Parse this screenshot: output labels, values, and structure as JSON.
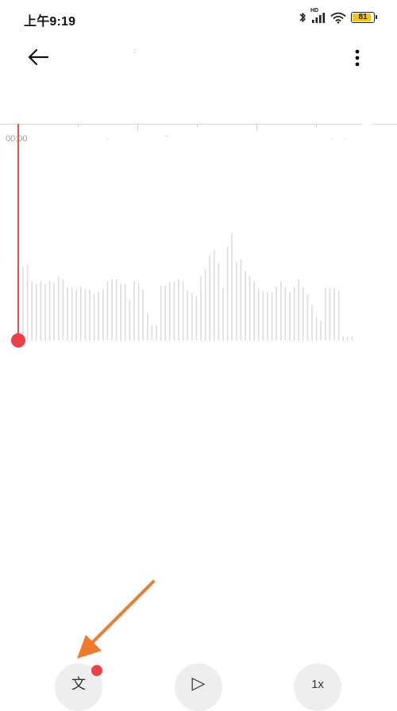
{
  "status_bar": {
    "time": "上午9:19",
    "network_label": "HD",
    "battery_level": "81",
    "battery_fraction": 0.81,
    "icons": [
      "bluetooth-icon",
      "signal-icon",
      "wifi-icon",
      "battery-icon"
    ]
  },
  "toolbar": {
    "back_icon": "arrow-left-icon",
    "title": "=",
    "more_icon": "more-vertical-icon"
  },
  "timeline": {
    "start_time": "00:00",
    "faint_marks": [
      "-",
      "–",
      "·",
      "·"
    ]
  },
  "waveform": {
    "accent_color": "#ee4b4b",
    "bar_color": "#dcdcdc",
    "levels": [
      0.56,
      0.58,
      0.45,
      0.43,
      0.45,
      0.43,
      0.45,
      0.44,
      0.49,
      0.47,
      0.41,
      0.41,
      0.39,
      0.41,
      0.39,
      0.39,
      0.35,
      0.37,
      0.39,
      0.45,
      0.47,
      0.47,
      0.43,
      0.43,
      0.31,
      0.45,
      0.44,
      0.39,
      0.21,
      0.12,
      0.12,
      0.42,
      0.42,
      0.45,
      0.45,
      0.47,
      0.45,
      0.38,
      0.36,
      0.34,
      0.49,
      0.54,
      0.65,
      0.69,
      0.59,
      0.4,
      0.72,
      0.82,
      0.6,
      0.62,
      0.53,
      0.49,
      0.45,
      0.4,
      0.38,
      0.37,
      0.37,
      0.41,
      0.45,
      0.41,
      0.37,
      0.41,
      0.47,
      0.41,
      0.35,
      0.27,
      0.18,
      0.15,
      0.4,
      0.4,
      0.4,
      0.38,
      0.03,
      0.03,
      0.03
    ],
    "annotation_color": "#f07a2c"
  },
  "controls": {
    "mark_glyph": "文",
    "play_glyph": "▷",
    "speed_glyph": "1x",
    "mark_icon": "tag-icon",
    "play_icon": "play-icon",
    "speed_icon": "speed-icon"
  }
}
